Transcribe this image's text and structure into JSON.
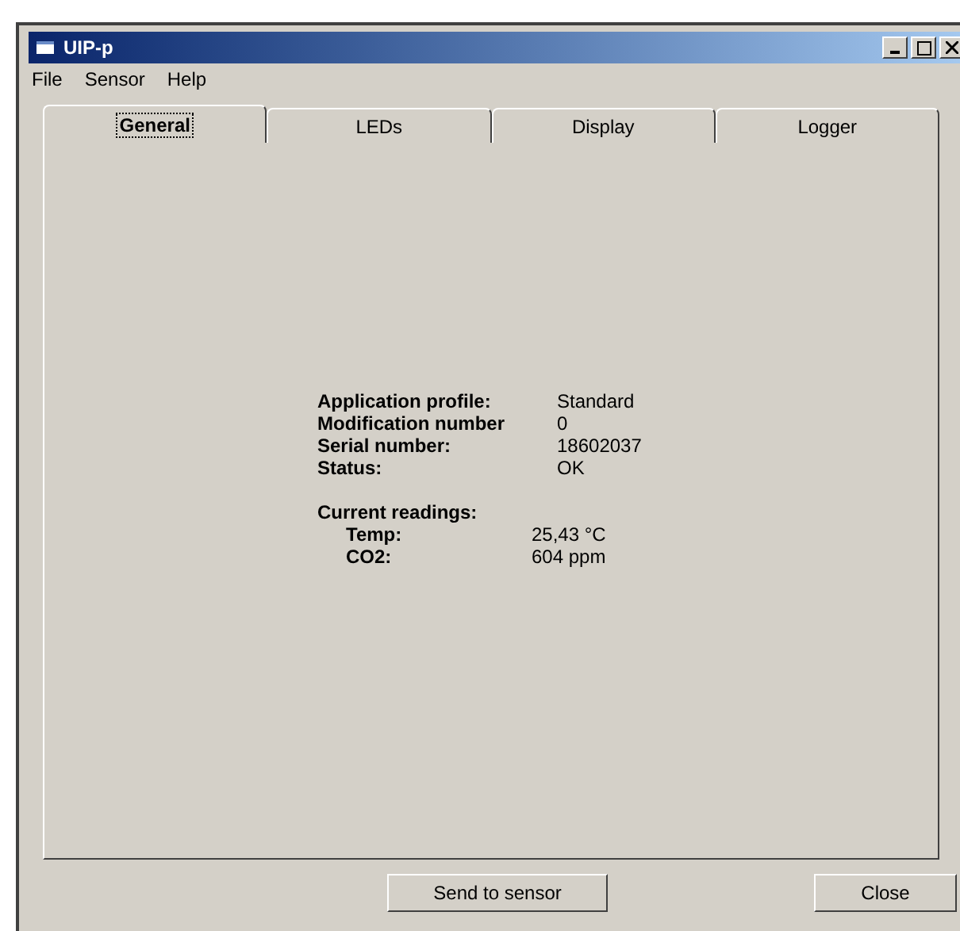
{
  "window": {
    "title": "UIP-p"
  },
  "menu": [
    "File",
    "Sensor",
    "Help"
  ],
  "tabs": [
    {
      "label": "General",
      "selected": true
    },
    {
      "label": "LEDs",
      "selected": false
    },
    {
      "label": "Display",
      "selected": false
    },
    {
      "label": "Logger",
      "selected": false
    }
  ],
  "info": [
    {
      "label": "Application profile:",
      "value": "Standard"
    },
    {
      "label": "Modification number",
      "value": "0"
    },
    {
      "label": "Serial number:",
      "value": "18602037"
    },
    {
      "label": "Status:",
      "value": "OK"
    }
  ],
  "readings": {
    "heading": "Current readings:",
    "items": [
      {
        "label": "Temp:",
        "value": "25,43 °C"
      },
      {
        "label": "CO2:",
        "value": "604 ppm"
      }
    ]
  },
  "buttons": [
    "Send to sensor",
    "Close"
  ]
}
